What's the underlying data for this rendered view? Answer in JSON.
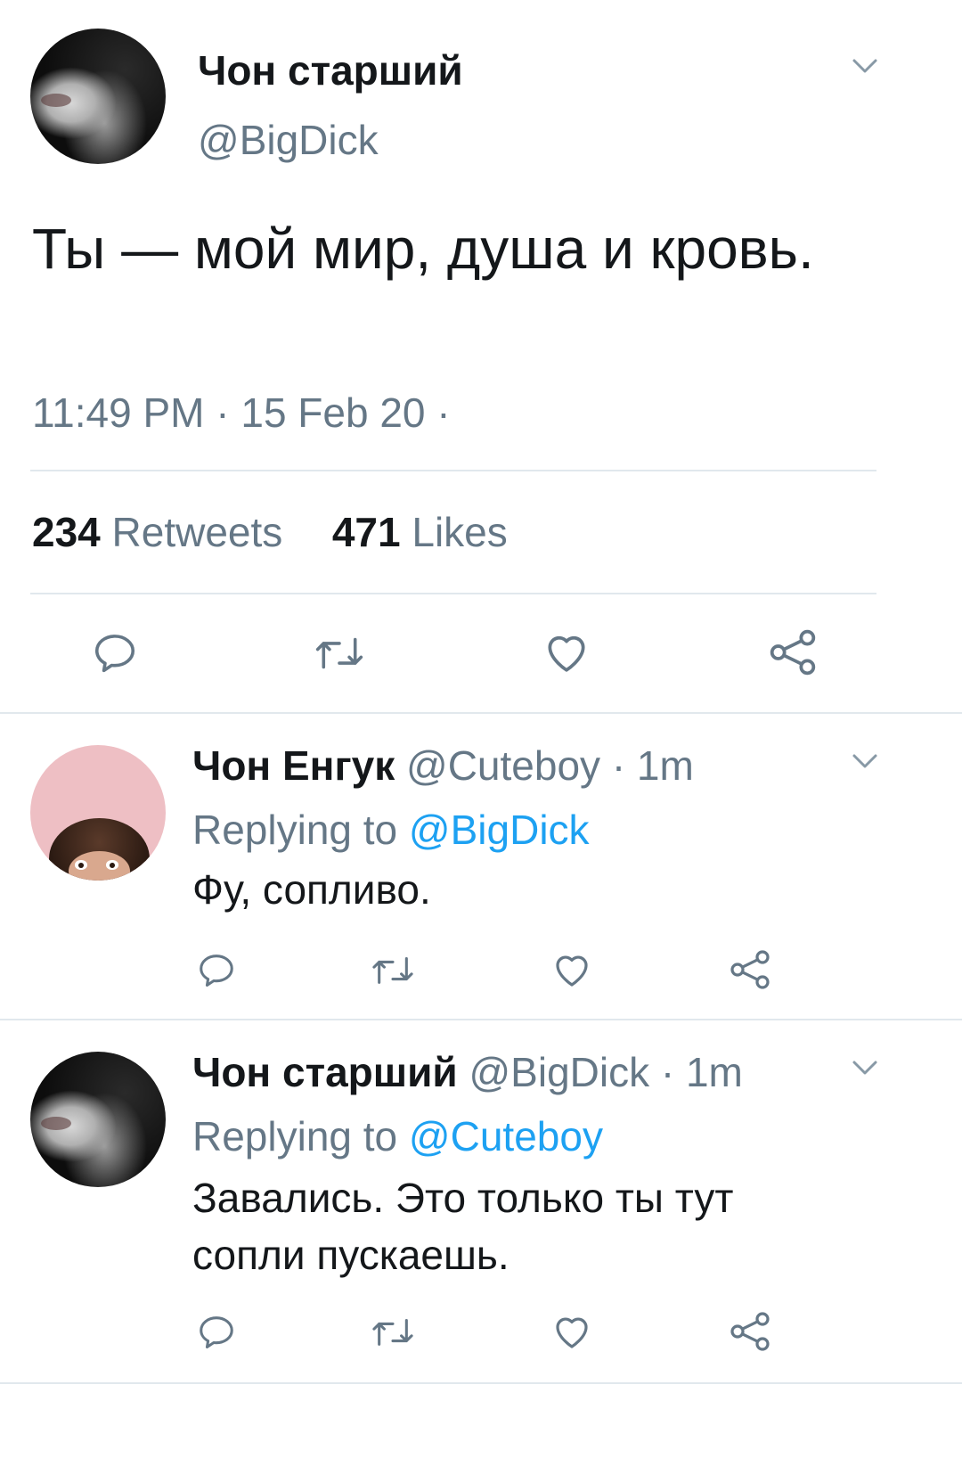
{
  "colors": {
    "text_primary": "#14171a",
    "text_secondary": "#657786",
    "link": "#1da1f2",
    "divider": "#e1e8ed",
    "icon": "#657786"
  },
  "main_tweet": {
    "author_name": "Чон старший",
    "author_handle": "@BigDick",
    "text": "Ты — мой мир, душа и кровь.",
    "timestamp": "11:49 PM · 15 Feb 20 ·",
    "retweets_count": "234",
    "retweets_label": "Retweets",
    "likes_count": "471",
    "likes_label": "Likes",
    "icons": [
      "reply-icon",
      "retweet-icon",
      "like-icon",
      "share-icon",
      "chevron-down-icon"
    ]
  },
  "replies": [
    {
      "author_name": "Чон Енгук",
      "author_handle": "@Cuteboy",
      "time": "· 1m",
      "replying_prefix": "Replying to",
      "replying_to": "@BigDick",
      "text": "Фу, сопливо."
    },
    {
      "author_name": "Чон старший",
      "author_handle": "@BigDick",
      "time": "· 1m",
      "replying_prefix": "Replying to",
      "replying_to": "@Cuteboy",
      "text": "Завались. Это только ты тут сопли пускаешь."
    }
  ]
}
